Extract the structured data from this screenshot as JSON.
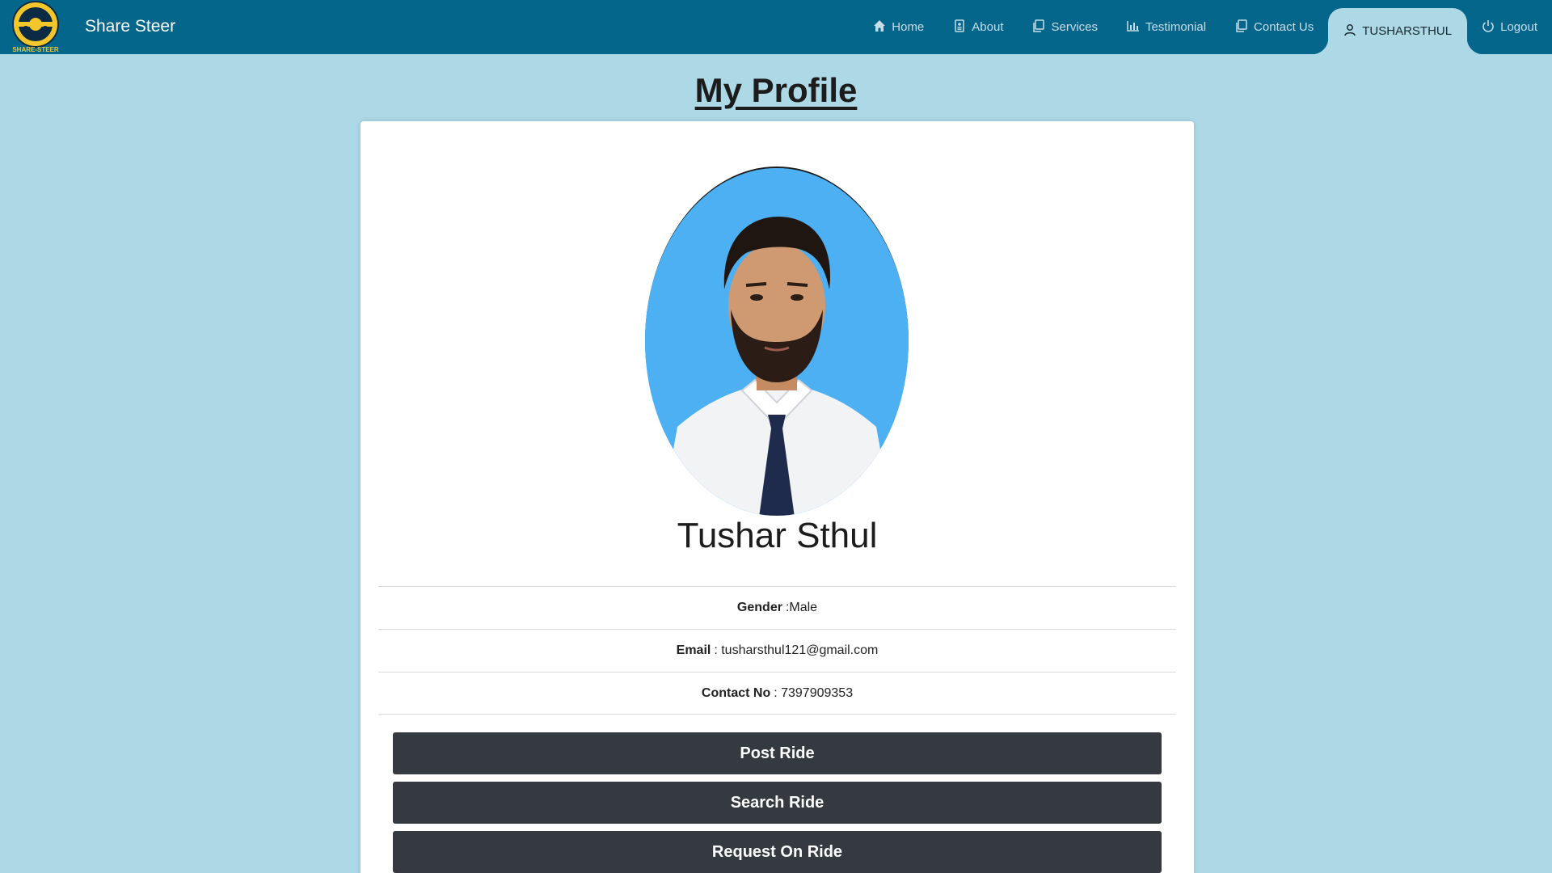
{
  "header": {
    "brand_name": "Share Steer",
    "logo_text": "SHARE-STEER"
  },
  "nav": {
    "items": [
      {
        "label": "Home",
        "icon": "home-icon"
      },
      {
        "label": "About",
        "icon": "document-icon"
      },
      {
        "label": "Services",
        "icon": "copy-icon"
      },
      {
        "label": "Testimonial",
        "icon": "bar-chart-icon"
      },
      {
        "label": "Contact Us",
        "icon": "copy-icon"
      },
      {
        "label": "TUSHARSTHUL",
        "icon": "user-icon",
        "active": true
      },
      {
        "label": "Logout",
        "icon": "power-icon"
      }
    ]
  },
  "main": {
    "title": "My Profile",
    "profile": {
      "name": "Tushar Sthul",
      "gender_label": "Gender",
      "gender_value": ":Male",
      "email_label": "Email",
      "email_value": ": tusharsthul121@gmail.com",
      "contact_label": "Contact No",
      "contact_value": ": 7397909353"
    },
    "buttons": {
      "post_ride": "Post Ride",
      "search_ride": "Search Ride",
      "request_ride": "Request On Ride"
    }
  },
  "colors": {
    "navbar": "#05668b",
    "page_bg": "#add8e6",
    "button_bg": "#343a40",
    "avatar_bg": "#4cb0f2"
  }
}
